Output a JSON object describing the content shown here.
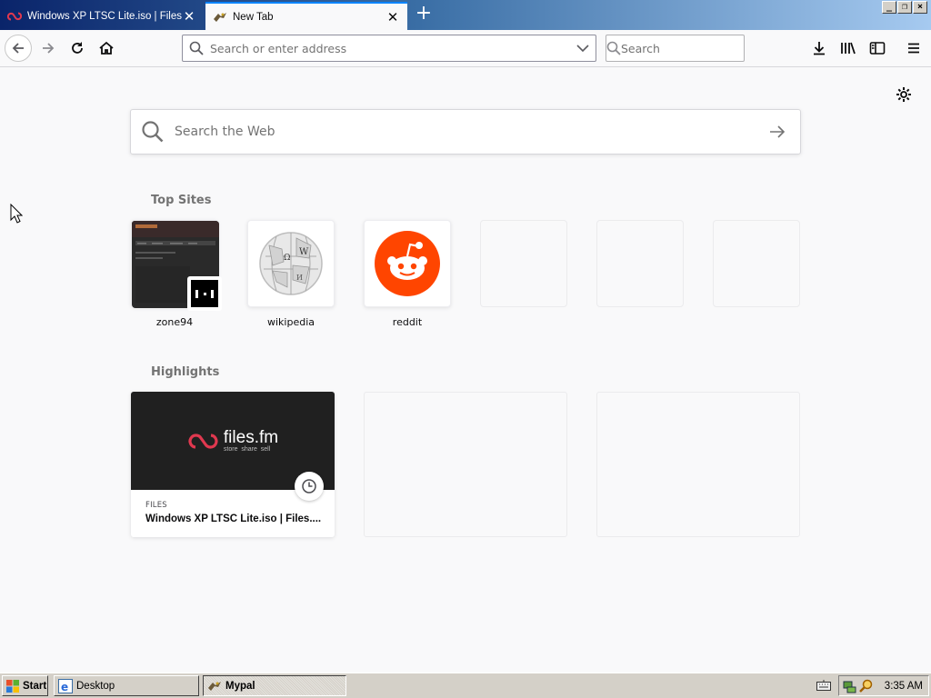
{
  "tabs": [
    {
      "title": "Windows XP LTSC Lite.iso | Files.fm",
      "active": false
    },
    {
      "title": "New Tab",
      "active": true
    }
  ],
  "window_controls": {
    "minimize": "_",
    "restore": "❐",
    "close": "×"
  },
  "urlbar": {
    "placeholder": "Search or enter address",
    "value": ""
  },
  "searchbar": {
    "placeholder": "Search"
  },
  "newtab": {
    "search_placeholder": "Search the Web",
    "top_sites_title": "Top Sites",
    "top_sites": [
      {
        "label": "zone94"
      },
      {
        "label": "wikipedia"
      },
      {
        "label": "reddit"
      }
    ],
    "highlights_title": "Highlights",
    "highlights": [
      {
        "context": "FILES",
        "title": "Windows XP LTSC Lite.iso | Files....",
        "logo_text": "files.fm",
        "logo_tagline": "store  share  sell"
      }
    ]
  },
  "taskbar": {
    "start_label": "Start",
    "tasks": [
      {
        "label": "Desktop",
        "active": false
      },
      {
        "label": "Mypal",
        "active": true
      }
    ],
    "clock": "3:35 AM"
  },
  "colors": {
    "accent": "#0a84ff",
    "reddit": "#ff4500",
    "filesfm": "#e0384f",
    "titlebar_start": "#0a246a"
  }
}
